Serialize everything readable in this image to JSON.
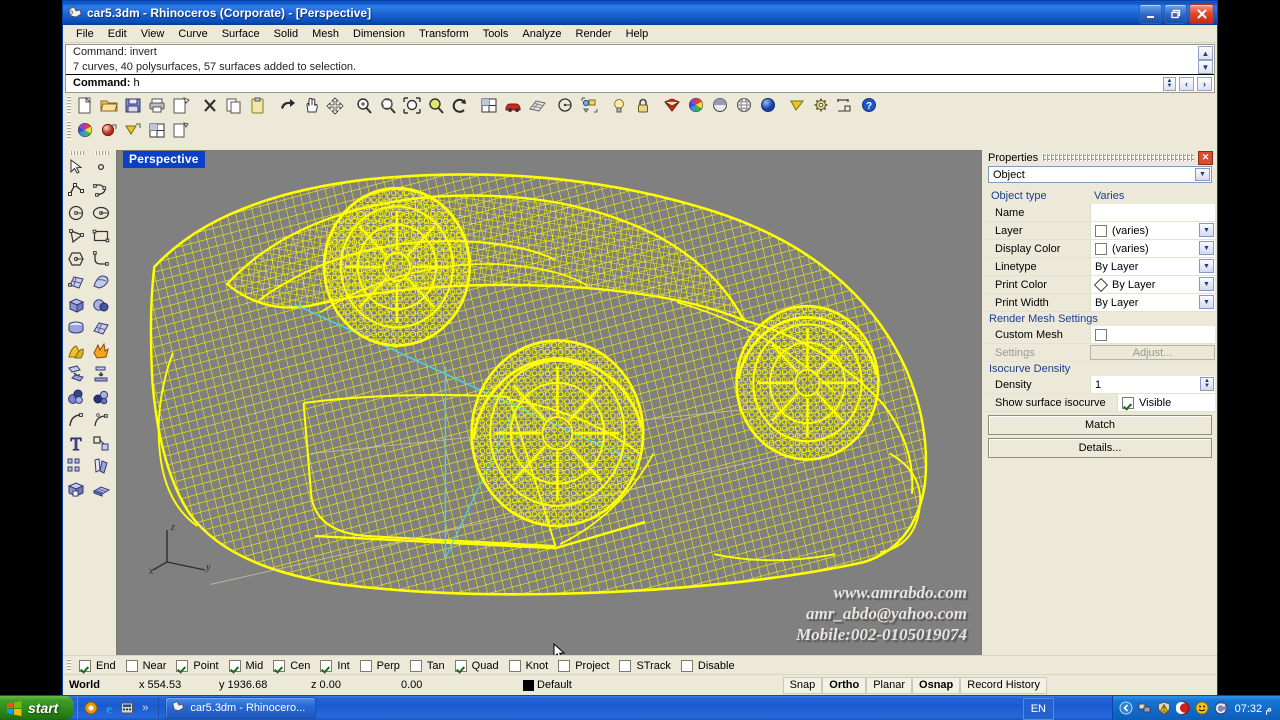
{
  "window": {
    "title": "car5.3dm - Rhinoceros (Corporate) - [Perspective]",
    "minimize_label": "_",
    "restore_label": "❐",
    "close_label": "✕"
  },
  "menu": {
    "items": [
      "File",
      "Edit",
      "View",
      "Curve",
      "Surface",
      "Solid",
      "Mesh",
      "Dimension",
      "Transform",
      "Tools",
      "Analyze",
      "Render",
      "Help"
    ]
  },
  "command": {
    "history": [
      "Command: invert",
      "7 curves, 40 polysurfaces, 57 surfaces added to selection."
    ],
    "prompt_label": "Command:",
    "prompt_value": "h",
    "scroll_up": "▲",
    "scroll_down": "▼",
    "nav_prev": "‹",
    "nav_next": "›"
  },
  "toolbar_main": {
    "icons": [
      "new-file-icon",
      "open-folder-icon",
      "save-icon",
      "print-icon",
      "print-preview-icon",
      "delete-icon",
      "copy-icon",
      "paste-icon",
      "undo-icon",
      "pan-icon",
      "move-icon",
      "zoom-in-icon",
      "zoom-window-icon",
      "zoom-extents-icon",
      "zoom-selected-icon",
      "rotate-view-icon",
      "four-view-icon",
      "car-render-icon",
      "mesh-grid-icon",
      "circle-center-icon",
      "group-objects-icon",
      "light-bulb-icon",
      "lock-icon",
      "material-icon",
      "color-wheel-icon",
      "hemisphere-icon",
      "sphere-wire-icon",
      "sphere-shaded-icon",
      "triangle-flag-icon",
      "gear-icon",
      "dimension-icon",
      "help-icon"
    ]
  },
  "toolbar_second": {
    "icons": [
      "color-wheel-icon",
      "render-sphere-icon",
      "flag-render-icon",
      "viewport-layout-icon",
      "new-view-icon"
    ]
  },
  "sidebar": {
    "left_column_icons": [
      "select-arrow-icon",
      "polyline-icon",
      "circle-icon",
      "polygon-icon",
      "ellipse-icon",
      "surface-edit-icon",
      "box-icon",
      "cylinder-icon",
      "boolean-union-icon",
      "extrude-down-icon",
      "sphere-group-icon",
      "arc-blend-icon",
      "text-tool-icon",
      "array-icon",
      "solid-box-icon"
    ],
    "right_column_icons": [
      "point-icon",
      "curve-interp-icon",
      "ellipse-center-icon",
      "rectangle-icon",
      "curve-corner-icon",
      "surface-sweep-icon",
      "sphere-boolean-icon",
      "surface-patch-icon",
      "explode-icon",
      "extrude-flat-icon",
      "boolean-difference-icon",
      "curve-fillet-icon",
      "offset-icon",
      "rotate-copy-icon",
      "mesh-solid-icon"
    ]
  },
  "viewport": {
    "label": "Perspective",
    "background_color": "#808080",
    "wireframe_color": "#ffff00",
    "axis": {
      "x": "x",
      "y": "y",
      "z": "z"
    },
    "watermark": [
      "www.amrabdo.com",
      "amr_abdo@yahoo.com",
      "Mobile:002-0105019074"
    ]
  },
  "properties": {
    "panel_title": "Properties",
    "close_label": "✕",
    "selector_value": "Object",
    "header_left": "Object type",
    "header_right": "Varies",
    "rows": [
      {
        "label": "Name",
        "value": "",
        "has_dropdown": false,
        "has_checkbox": false
      },
      {
        "label": "Layer",
        "value": "(varies)",
        "has_dropdown": true,
        "has_checkbox": true
      },
      {
        "label": "Display Color",
        "value": "(varies)",
        "has_dropdown": true,
        "has_checkbox": true
      },
      {
        "label": "Linetype",
        "value": "By Layer",
        "has_dropdown": true,
        "has_checkbox": false
      },
      {
        "label": "Print Color",
        "value": "By Layer",
        "has_dropdown": true,
        "has_checkbox": false,
        "has_diamond": true
      },
      {
        "label": "Print Width",
        "value": "By Layer",
        "has_dropdown": true,
        "has_checkbox": false
      }
    ],
    "render_mesh": {
      "section": "Render Mesh Settings",
      "custom_mesh_label": "Custom Mesh",
      "custom_mesh_checked": false,
      "settings_label": "Settings",
      "adjust_label": "Adjust..."
    },
    "isocurve": {
      "section": "Isocurve Density",
      "density_label": "Density",
      "density_value": "1",
      "show_label": "Show surface isocurve",
      "visible_label": "Visible",
      "visible_checked": true
    },
    "buttons": {
      "match": "Match",
      "details": "Details..."
    }
  },
  "osnap": {
    "items": [
      {
        "label": "End",
        "checked": true
      },
      {
        "label": "Near",
        "checked": false
      },
      {
        "label": "Point",
        "checked": true
      },
      {
        "label": "Mid",
        "checked": true
      },
      {
        "label": "Cen",
        "checked": true
      },
      {
        "label": "Int",
        "checked": true
      },
      {
        "label": "Perp",
        "checked": false
      },
      {
        "label": "Tan",
        "checked": false
      },
      {
        "label": "Quad",
        "checked": true
      },
      {
        "label": "Knot",
        "checked": false
      },
      {
        "label": "Project",
        "checked": false
      },
      {
        "label": "STrack",
        "checked": false
      },
      {
        "label": "Disable",
        "checked": false
      }
    ]
  },
  "statusbar": {
    "cplane": "World",
    "x": "x 554.53",
    "y": "y 1936.68",
    "z": "z 0.00",
    "extra": "0.00",
    "layer": "Default",
    "toggles": [
      {
        "label": "Snap",
        "active": false
      },
      {
        "label": "Ortho",
        "active": true
      },
      {
        "label": "Planar",
        "active": false
      },
      {
        "label": "Osnap",
        "active": true
      },
      {
        "label": "Record History",
        "active": false
      }
    ]
  },
  "taskbar": {
    "start_label": "start",
    "quick_launch": [
      "media-player-icon",
      "internet-explorer-icon",
      "calculator-icon",
      "chevron-more-icon"
    ],
    "tasks": [
      {
        "label": "car5.3dm - Rhinocero...",
        "icon": "rhino-icon"
      }
    ],
    "language": "EN",
    "tray_icons": [
      "chevron-left-icon",
      "network-icon",
      "warning-shield-icon",
      "antivirus-icon",
      "smiley-icon",
      "update-icon"
    ],
    "clock": "07:32 م"
  }
}
